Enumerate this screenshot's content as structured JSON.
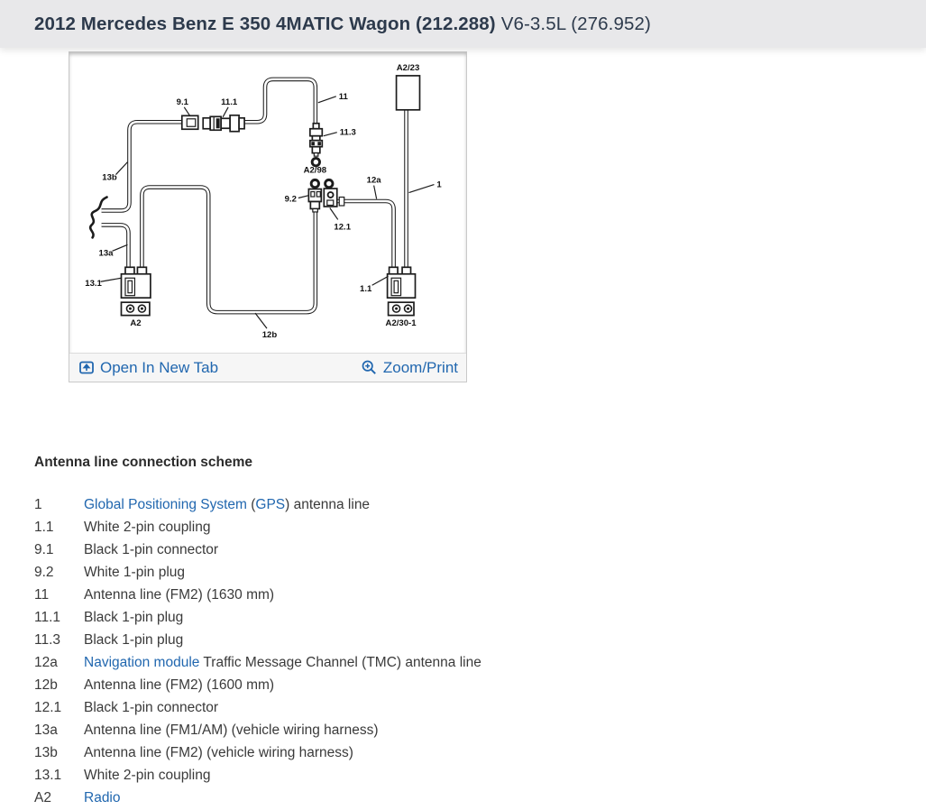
{
  "header": {
    "title_bold": "2012 Mercedes Benz E 350 4MATIC Wagon (212.288)",
    "title_regular": "V6-3.5L (276.952)"
  },
  "colors": {
    "accent_link": "#2167af",
    "header_bg": "#e8e8ea",
    "title_text": "#2d3a4c",
    "panel_footer_bg": "#f6f6f6"
  },
  "diagram_panel": {
    "open_in_new_tab_label": "Open In New Tab",
    "zoom_print_label": "Zoom/Print",
    "callouts": {
      "a2_23": "A2/23",
      "c11": "11",
      "c9_1": "9.1",
      "c11_1": "11.1",
      "c11_3": "11.3",
      "a2_98": "A2/98",
      "c9_2": "9.2",
      "c12_1": "12.1",
      "c12a": "12a",
      "c1": "1",
      "c13b": "13b",
      "c13a": "13a",
      "c13_1": "13.1",
      "a2": "A2",
      "c12b": "12b",
      "c1_1": "1.1",
      "a2_30_1": "A2/30-1"
    }
  },
  "legend": {
    "heading": "Antenna line connection scheme",
    "items": [
      {
        "id": "1",
        "parts": [
          {
            "t": "Global Positioning System",
            "link": true
          },
          {
            "t": " (",
            "link": false
          },
          {
            "t": "GPS",
            "link": true
          },
          {
            "t": ") antenna line",
            "link": false
          }
        ]
      },
      {
        "id": "1.1",
        "parts": [
          {
            "t": "White 2-pin coupling",
            "link": false
          }
        ]
      },
      {
        "id": "9.1",
        "parts": [
          {
            "t": "Black 1-pin connector",
            "link": false
          }
        ]
      },
      {
        "id": "9.2",
        "parts": [
          {
            "t": "White 1-pin plug",
            "link": false
          }
        ]
      },
      {
        "id": "11",
        "parts": [
          {
            "t": "Antenna line (FM2) (1630 mm)",
            "link": false
          }
        ]
      },
      {
        "id": "11.1",
        "parts": [
          {
            "t": "Black 1-pin plug",
            "link": false
          }
        ]
      },
      {
        "id": "11.3",
        "parts": [
          {
            "t": "Black 1-pin plug",
            "link": false
          }
        ]
      },
      {
        "id": "12a",
        "parts": [
          {
            "t": "Navigation module",
            "link": true
          },
          {
            "t": " Traffic Message Channel (TMC) antenna line",
            "link": false
          }
        ]
      },
      {
        "id": "12b",
        "parts": [
          {
            "t": "Antenna line (FM2) (1600 mm)",
            "link": false
          }
        ]
      },
      {
        "id": "12.1",
        "parts": [
          {
            "t": "Black 1-pin connector",
            "link": false
          }
        ]
      },
      {
        "id": "13a",
        "parts": [
          {
            "t": "Antenna line (FM1/AM) (vehicle wiring harness)",
            "link": false
          }
        ]
      },
      {
        "id": "13b",
        "parts": [
          {
            "t": "Antenna line (FM2) (vehicle wiring harness)",
            "link": false
          }
        ]
      },
      {
        "id": "13.1",
        "parts": [
          {
            "t": "White 2-pin coupling",
            "link": false
          }
        ]
      },
      {
        "id": "A2",
        "parts": [
          {
            "t": "Radio",
            "link": true
          }
        ]
      }
    ]
  }
}
